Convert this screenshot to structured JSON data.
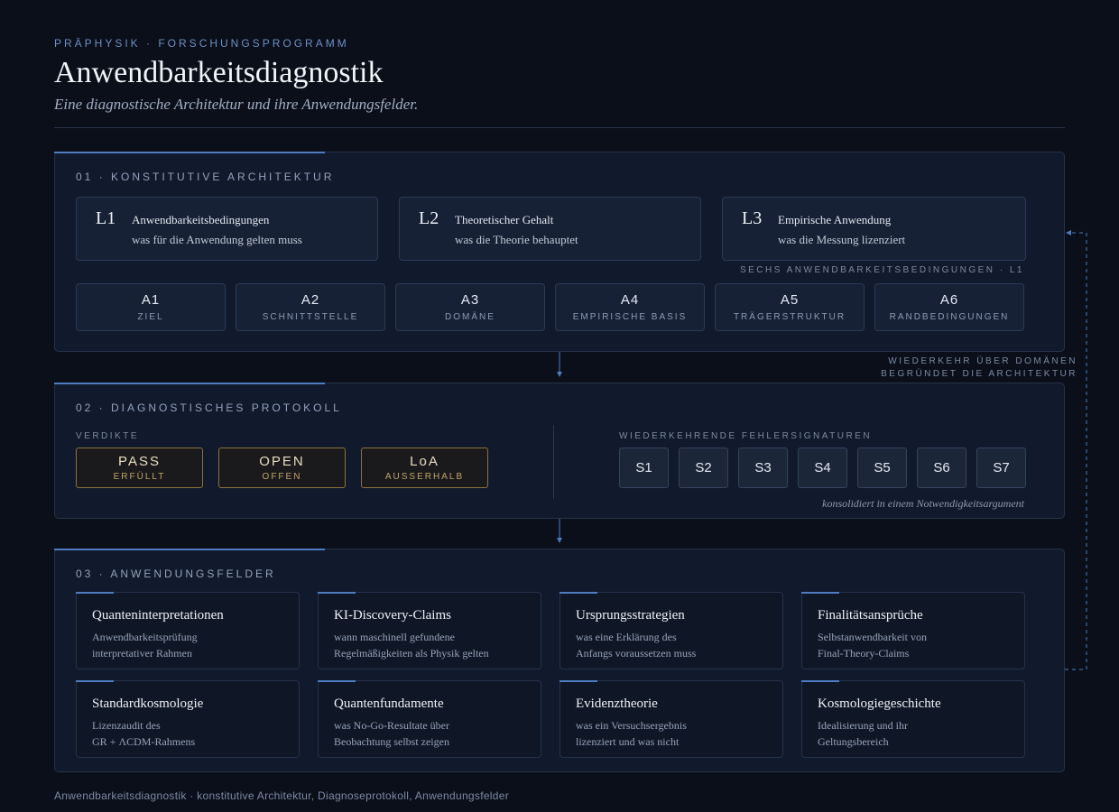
{
  "header": {
    "eyebrow": "PRÄPHYSIK · FORSCHUNGSPROGRAMM",
    "title": "Anwendbarkeitsdiagnostik",
    "subtitle": "Eine diagnostische Architektur und ihre Anwendungsfelder."
  },
  "section1": {
    "label": "01 · KONSTITUTIVE ARCHITEKTUR",
    "layers": [
      {
        "code": "L1",
        "title": "Anwendbarkeitsbedingungen",
        "desc": "was für die Anwendung gelten muss"
      },
      {
        "code": "L2",
        "title": "Theoretischer Gehalt",
        "desc": "was die Theorie behauptet"
      },
      {
        "code": "L3",
        "title": "Empirische Anwendung",
        "desc": "was die Messung lizenziert"
      }
    ],
    "conditions_note": "SECHS ANWENDBARKEITSBEDINGUNGEN · L1",
    "conditions": [
      {
        "key": "A1",
        "label": "ZIEL"
      },
      {
        "key": "A2",
        "label": "SCHNITTSTELLE"
      },
      {
        "key": "A3",
        "label": "DOMÄNE"
      },
      {
        "key": "A4",
        "label": "EMPIRISCHE BASIS"
      },
      {
        "key": "A5",
        "label": "TRÄGERSTRUKTUR"
      },
      {
        "key": "A6",
        "label": "RANDBEDINGUNGEN"
      }
    ]
  },
  "feedback_note": [
    "WIEDERKEHR ÜBER DOMÄNEN",
    "BEGRÜNDET DIE ARCHITEKTUR"
  ],
  "section2": {
    "label": "02 · DIAGNOSTISCHES PROTOKOLL",
    "verdicts_label": "VERDIKTE",
    "verdicts": [
      {
        "key": "PASS",
        "label": "ERFÜLLT"
      },
      {
        "key": "OPEN",
        "label": "OFFEN"
      },
      {
        "key": "LoA",
        "label": "AUSSERHALB"
      }
    ],
    "signatures_label": "WIEDERKEHRENDE FEHLERSIGNATUREN",
    "signatures": [
      "S1",
      "S2",
      "S3",
      "S4",
      "S5",
      "S6",
      "S7"
    ],
    "signatures_note": "konsolidiert in einem Notwendigkeitsargument"
  },
  "section3": {
    "label": "03 · ANWENDUNGSFELDER",
    "fields": [
      {
        "title": "Quanteninterpretationen",
        "desc": [
          "Anwendbarkeitsprüfung",
          "interpretativer Rahmen"
        ]
      },
      {
        "title": "KI-Discovery-Claims",
        "desc": [
          "wann maschinell gefundene",
          "Regelmäßigkeiten als Physik gelten"
        ]
      },
      {
        "title": "Ursprungsstrategien",
        "desc": [
          "was eine Erklärung des",
          "Anfangs voraussetzen muss"
        ]
      },
      {
        "title": "Finalitätsansprüche",
        "desc": [
          "Selbstanwendbarkeit von",
          "Final-Theory-Claims"
        ]
      },
      {
        "title": "Standardkosmologie",
        "desc": [
          "Lizenzaudit des",
          "GR + ΛCDM-Rahmens"
        ]
      },
      {
        "title": "Quantenfundamente",
        "desc": [
          "was No-Go-Resultate über",
          "Beobachtung selbst zeigen"
        ]
      },
      {
        "title": "Evidenztheorie",
        "desc": [
          "was ein Versuchsergebnis",
          "lizenziert und was nicht"
        ]
      },
      {
        "title": "Kosmologiegeschichte",
        "desc": [
          "Idealisierung und ihr",
          "Geltungsbereich"
        ]
      }
    ]
  },
  "footer": "Anwendbarkeitsdiagnostik · konstitutive Architektur, Diagnoseprotokoll, Anwendungsfelder",
  "colors": {
    "accent": "#4f7bc0",
    "verdict_border": "#8a7140",
    "background": "#0a0f1a"
  }
}
